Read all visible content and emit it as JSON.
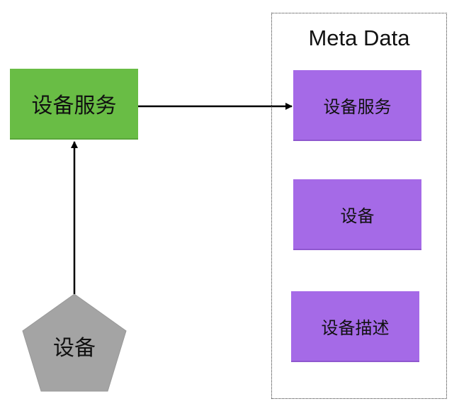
{
  "nodes": {
    "device_service": "设备服务",
    "device": "设备"
  },
  "meta_data": {
    "title": "Meta Data",
    "items": [
      "设备服务",
      "设备",
      "设备描述"
    ]
  },
  "colors": {
    "service_fill": "#69bd45",
    "meta_item_fill": "#a56ae7",
    "device_fill": "#a4a4a4",
    "arrow": "#000000"
  }
}
